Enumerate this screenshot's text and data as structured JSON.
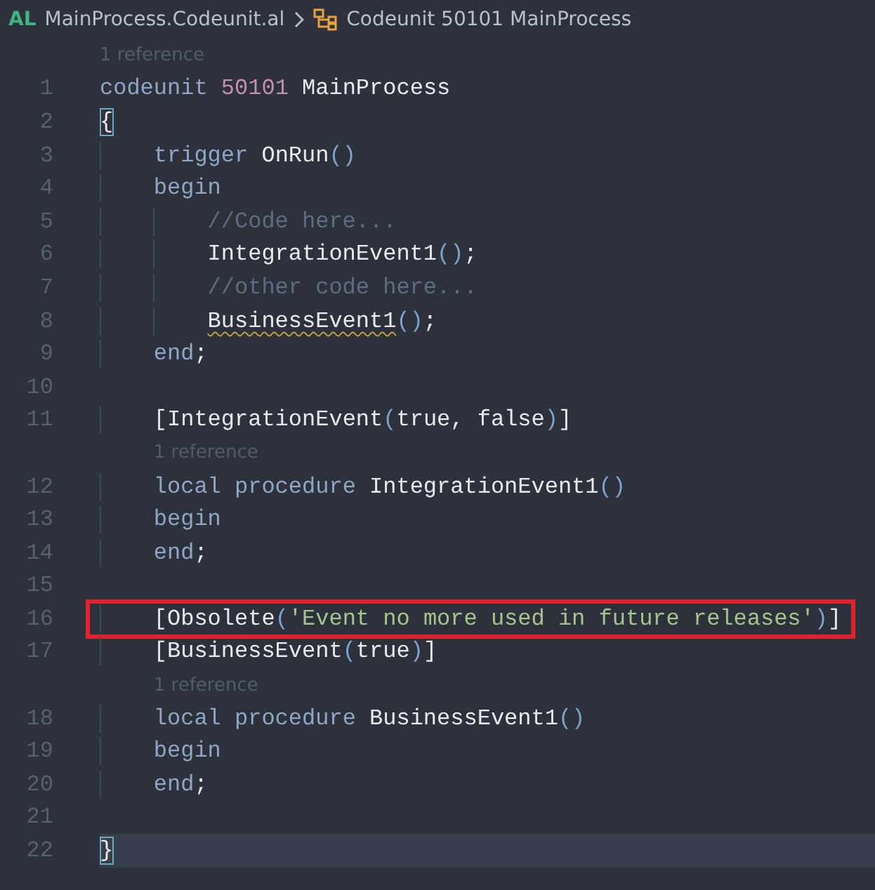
{
  "breadcrumb": {
    "language": "AL",
    "file": "MainProcess.Codeunit.al",
    "symbol": "Codeunit 50101 MainProcess"
  },
  "lines": [
    {
      "kind": "codelens",
      "text": "1 reference"
    },
    {
      "kind": "code",
      "number": "1",
      "tokens": [
        {
          "kind": "keyword",
          "text": "codeunit"
        },
        {
          "kind": "number",
          "text": " 50101"
        },
        {
          "kind": "ident",
          "text": " MainProcess"
        }
      ]
    },
    {
      "kind": "code",
      "number": "2",
      "tokens": [
        {
          "kind": "ident",
          "text": "{",
          "matched": true
        }
      ]
    },
    {
      "kind": "code",
      "number": "3",
      "tokens": [
        {
          "kind": "indent"
        },
        {
          "kind": "keyword",
          "text": "trigger"
        },
        {
          "kind": "ident",
          "text": " OnRun"
        },
        {
          "kind": "paren",
          "text": "()"
        }
      ]
    },
    {
      "kind": "code",
      "number": "4",
      "tokens": [
        {
          "kind": "indent"
        },
        {
          "kind": "keyword",
          "text": "begin"
        }
      ]
    },
    {
      "kind": "code",
      "number": "5",
      "tokens": [
        {
          "kind": "indent"
        },
        {
          "kind": "indent"
        },
        {
          "kind": "comment",
          "text": "//Code here..."
        }
      ]
    },
    {
      "kind": "code",
      "number": "6",
      "tokens": [
        {
          "kind": "indent"
        },
        {
          "kind": "indent"
        },
        {
          "kind": "ident",
          "text": "IntegrationEvent1"
        },
        {
          "kind": "paren",
          "text": "()"
        },
        {
          "kind": "ident",
          "text": ";"
        }
      ]
    },
    {
      "kind": "code",
      "number": "7",
      "tokens": [
        {
          "kind": "indent"
        },
        {
          "kind": "indent"
        },
        {
          "kind": "comment",
          "text": "//other code here..."
        }
      ]
    },
    {
      "kind": "code",
      "number": "8",
      "tokens": [
        {
          "kind": "indent"
        },
        {
          "kind": "indent"
        },
        {
          "kind": "ident",
          "text": "BusinessEvent1",
          "warning": true
        },
        {
          "kind": "paren",
          "text": "()"
        },
        {
          "kind": "ident",
          "text": ";"
        }
      ]
    },
    {
      "kind": "code",
      "number": "9",
      "tokens": [
        {
          "kind": "indent"
        },
        {
          "kind": "keyword",
          "text": "end"
        },
        {
          "kind": "ident",
          "text": ";"
        }
      ]
    },
    {
      "kind": "code",
      "number": "10"
    },
    {
      "kind": "code",
      "number": "11",
      "tokens": [
        {
          "kind": "indent"
        },
        {
          "kind": "ident",
          "text": "[IntegrationEvent"
        },
        {
          "kind": "paren",
          "text": "("
        },
        {
          "kind": "ident",
          "text": "true, false"
        },
        {
          "kind": "paren",
          "text": ")"
        },
        {
          "kind": "ident",
          "text": "]"
        }
      ]
    },
    {
      "kind": "codelens",
      "text": "1 reference"
    },
    {
      "kind": "code",
      "number": "12",
      "tokens": [
        {
          "kind": "indent"
        },
        {
          "kind": "keyword",
          "text": "local procedure"
        },
        {
          "kind": "ident",
          "text": " IntegrationEvent1"
        },
        {
          "kind": "paren",
          "text": "()"
        }
      ]
    },
    {
      "kind": "code",
      "number": "13",
      "tokens": [
        {
          "kind": "indent"
        },
        {
          "kind": "keyword",
          "text": "begin"
        }
      ]
    },
    {
      "kind": "code",
      "number": "14",
      "tokens": [
        {
          "kind": "indent"
        },
        {
          "kind": "keyword",
          "text": "end"
        },
        {
          "kind": "ident",
          "text": ";"
        }
      ]
    },
    {
      "kind": "code",
      "number": "15"
    },
    {
      "kind": "code",
      "number": "16",
      "highlighted": true,
      "tokens": [
        {
          "kind": "indent"
        },
        {
          "kind": "ident",
          "text": "[Obsolete"
        },
        {
          "kind": "paren",
          "text": "("
        },
        {
          "kind": "string",
          "text": "'Event no more used in future releases'"
        },
        {
          "kind": "paren",
          "text": ")"
        },
        {
          "kind": "ident",
          "text": "]"
        }
      ]
    },
    {
      "kind": "code",
      "number": "17",
      "tokens": [
        {
          "kind": "indent"
        },
        {
          "kind": "ident",
          "text": "[BusinessEvent"
        },
        {
          "kind": "paren",
          "text": "("
        },
        {
          "kind": "ident",
          "text": "true"
        },
        {
          "kind": "paren",
          "text": ")"
        },
        {
          "kind": "ident",
          "text": "]"
        }
      ]
    },
    {
      "kind": "codelens",
      "text": "1 reference"
    },
    {
      "kind": "code",
      "number": "18",
      "tokens": [
        {
          "kind": "indent"
        },
        {
          "kind": "keyword",
          "text": "local procedure"
        },
        {
          "kind": "ident",
          "text": " BusinessEvent1"
        },
        {
          "kind": "paren",
          "text": "()"
        }
      ]
    },
    {
      "kind": "code",
      "number": "19",
      "tokens": [
        {
          "kind": "indent"
        },
        {
          "kind": "keyword",
          "text": "begin"
        }
      ]
    },
    {
      "kind": "code",
      "number": "20",
      "tokens": [
        {
          "kind": "indent"
        },
        {
          "kind": "keyword",
          "text": "end"
        },
        {
          "kind": "ident",
          "text": ";"
        }
      ]
    },
    {
      "kind": "code",
      "number": "21"
    },
    {
      "kind": "code",
      "number": "22",
      "current": true,
      "tokens": [
        {
          "kind": "ident",
          "text": "}",
          "matched": true
        }
      ]
    }
  ]
}
